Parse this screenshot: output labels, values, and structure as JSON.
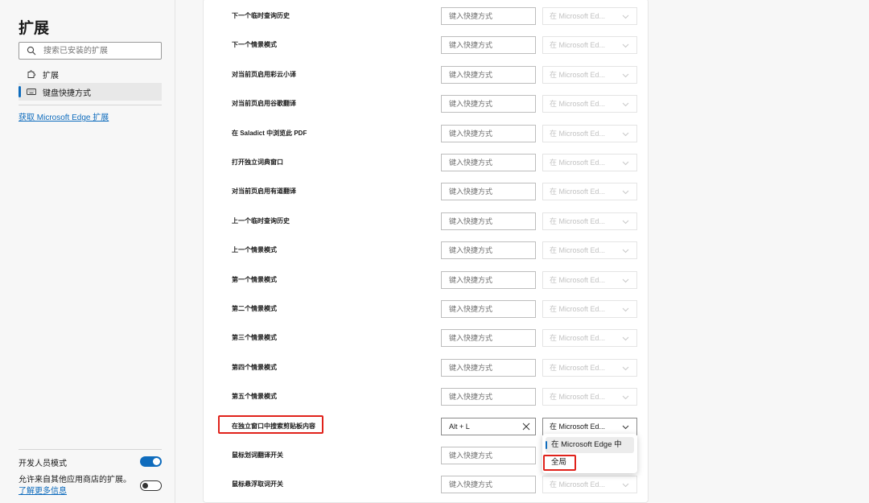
{
  "sidebar": {
    "title": "扩展",
    "search_placeholder": "搜索已安装的扩展",
    "items": [
      {
        "label": "扩展",
        "icon": "puzzle-icon"
      },
      {
        "label": "键盘快捷方式",
        "icon": "keyboard-icon",
        "active": true
      }
    ],
    "store_link": "获取 Microsoft Edge 扩展",
    "developer_mode": {
      "label": "开发人员模式",
      "on": true
    },
    "allow_other_stores": {
      "text": "允许来自其他应用商店的扩展。",
      "link": "了解更多信息",
      "on": false
    }
  },
  "shortcuts": [
    {
      "label": "下一个临时查询历史",
      "value": "",
      "placeholder": "键入快捷方式",
      "scope": "在 Microsoft Ed..."
    },
    {
      "label": "下一个情景模式",
      "value": "",
      "placeholder": "键入快捷方式",
      "scope": "在 Microsoft Ed..."
    },
    {
      "label": "对当前页启用彩云小译",
      "value": "",
      "placeholder": "键入快捷方式",
      "scope": "在 Microsoft Ed..."
    },
    {
      "label": "对当前页启用谷歌翻译",
      "value": "",
      "placeholder": "键入快捷方式",
      "scope": "在 Microsoft Ed..."
    },
    {
      "label": "在 Saladict 中浏览此 PDF",
      "value": "",
      "placeholder": "键入快捷方式",
      "scope": "在 Microsoft Ed..."
    },
    {
      "label": "打开独立词典窗口",
      "value": "",
      "placeholder": "键入快捷方式",
      "scope": "在 Microsoft Ed..."
    },
    {
      "label": "对当前页启用有道翻译",
      "value": "",
      "placeholder": "键入快捷方式",
      "scope": "在 Microsoft Ed..."
    },
    {
      "label": "上一个临时查询历史",
      "value": "",
      "placeholder": "键入快捷方式",
      "scope": "在 Microsoft Ed..."
    },
    {
      "label": "上一个情景模式",
      "value": "",
      "placeholder": "键入快捷方式",
      "scope": "在 Microsoft Ed..."
    },
    {
      "label": "第一个情景模式",
      "value": "",
      "placeholder": "键入快捷方式",
      "scope": "在 Microsoft Ed..."
    },
    {
      "label": "第二个情景模式",
      "value": "",
      "placeholder": "键入快捷方式",
      "scope": "在 Microsoft Ed..."
    },
    {
      "label": "第三个情景模式",
      "value": "",
      "placeholder": "键入快捷方式",
      "scope": "在 Microsoft Ed..."
    },
    {
      "label": "第四个情景模式",
      "value": "",
      "placeholder": "键入快捷方式",
      "scope": "在 Microsoft Ed..."
    },
    {
      "label": "第五个情景模式",
      "value": "",
      "placeholder": "键入快捷方式",
      "scope": "在 Microsoft Ed..."
    },
    {
      "label": "在独立窗口中搜索剪贴板内容",
      "value": "Alt + L",
      "placeholder": "键入快捷方式",
      "scope": "在 Microsoft Ed...",
      "enabled": true
    },
    {
      "label": "鼠标划词翻译开关",
      "value": "",
      "placeholder": "键入快捷方式",
      "scope": ""
    },
    {
      "label": "鼠标悬浮取词开关",
      "value": "",
      "placeholder": "键入快捷方式",
      "scope": "在 Microsoft Ed..."
    }
  ],
  "scope_dropdown": {
    "options": [
      "在 Microsoft Edge 中",
      "全局"
    ],
    "selected_index": 0
  },
  "colors": {
    "accent": "#0f6cbd",
    "highlight": "#e0221b"
  }
}
